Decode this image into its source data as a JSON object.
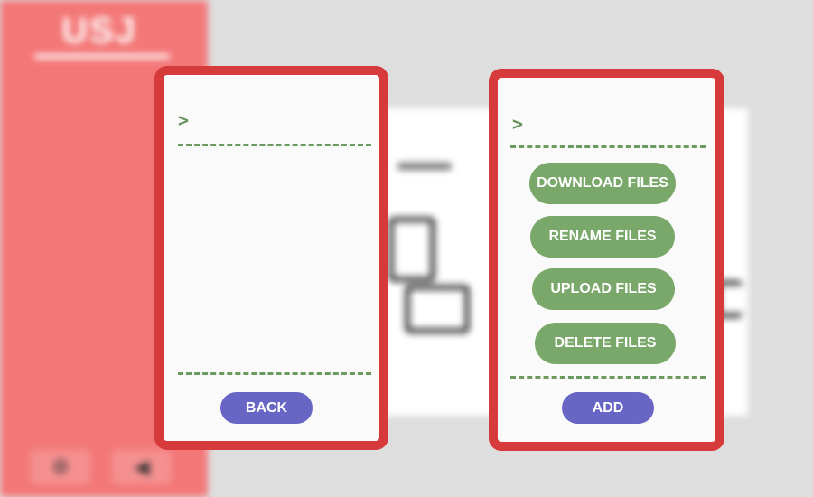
{
  "background": {
    "logo": "USJ",
    "subtitle": "",
    "icons": {
      "settings": "settings-icon",
      "sound": "sound-icon"
    }
  },
  "left_panel": {
    "prompt": ">",
    "back_label": "BACK"
  },
  "right_panel": {
    "prompt": ">",
    "actions": [
      {
        "label": "DOWNLOAD FILES"
      },
      {
        "label": "RENAME FILES"
      },
      {
        "label": "UPLOAD FILES"
      },
      {
        "label": "DELETE FILES"
      }
    ],
    "add_label": "ADD"
  },
  "colors": {
    "panel_border": "#d63a3a",
    "action_green": "#79a86a",
    "nav_blue": "#6866c4",
    "sidebar": "#f37777"
  }
}
